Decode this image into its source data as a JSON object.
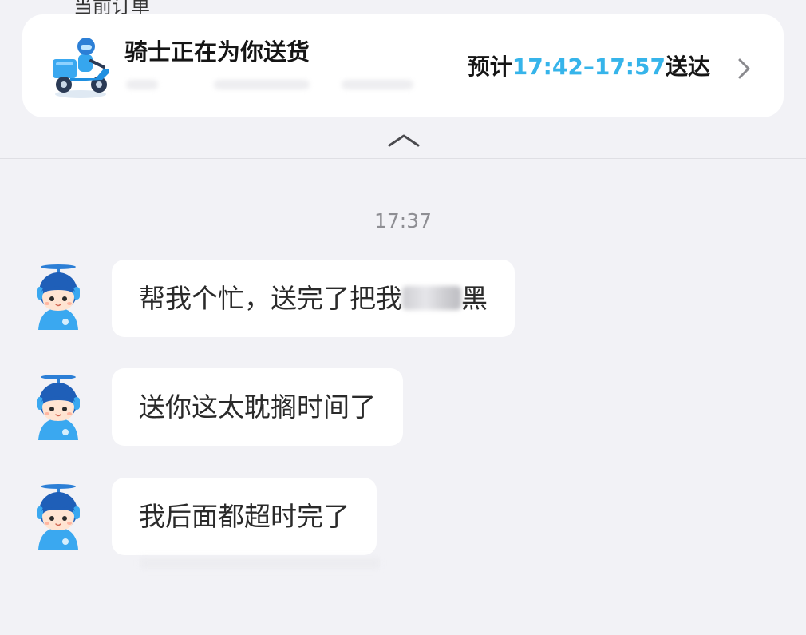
{
  "header": {
    "cut_title": "当前订单"
  },
  "order_card": {
    "title": "骑士正在为你送货",
    "eta_prefix": "预计",
    "eta_time": "17:42–17:57",
    "eta_suffix": "送达"
  },
  "chat": {
    "timestamp": "17:37",
    "messages": [
      {
        "text": "帮我个忙，送完了把我",
        "redacted": true,
        "redacted_tail": "黑"
      },
      {
        "text": "送你这太耽搁时间了"
      },
      {
        "text": "我后面都超时完了"
      }
    ]
  },
  "icons": {
    "rider": "delivery-rider-scooter-icon",
    "chevron": "chevron-right-icon",
    "collapse": "chevron-up-icon",
    "avatar": "rider-mascot-avatar"
  },
  "colors": {
    "background": "#f2f2f6",
    "card": "#ffffff",
    "accent": "#36b4ea",
    "text": "#1a1a1a",
    "muted": "#8e8e93"
  }
}
